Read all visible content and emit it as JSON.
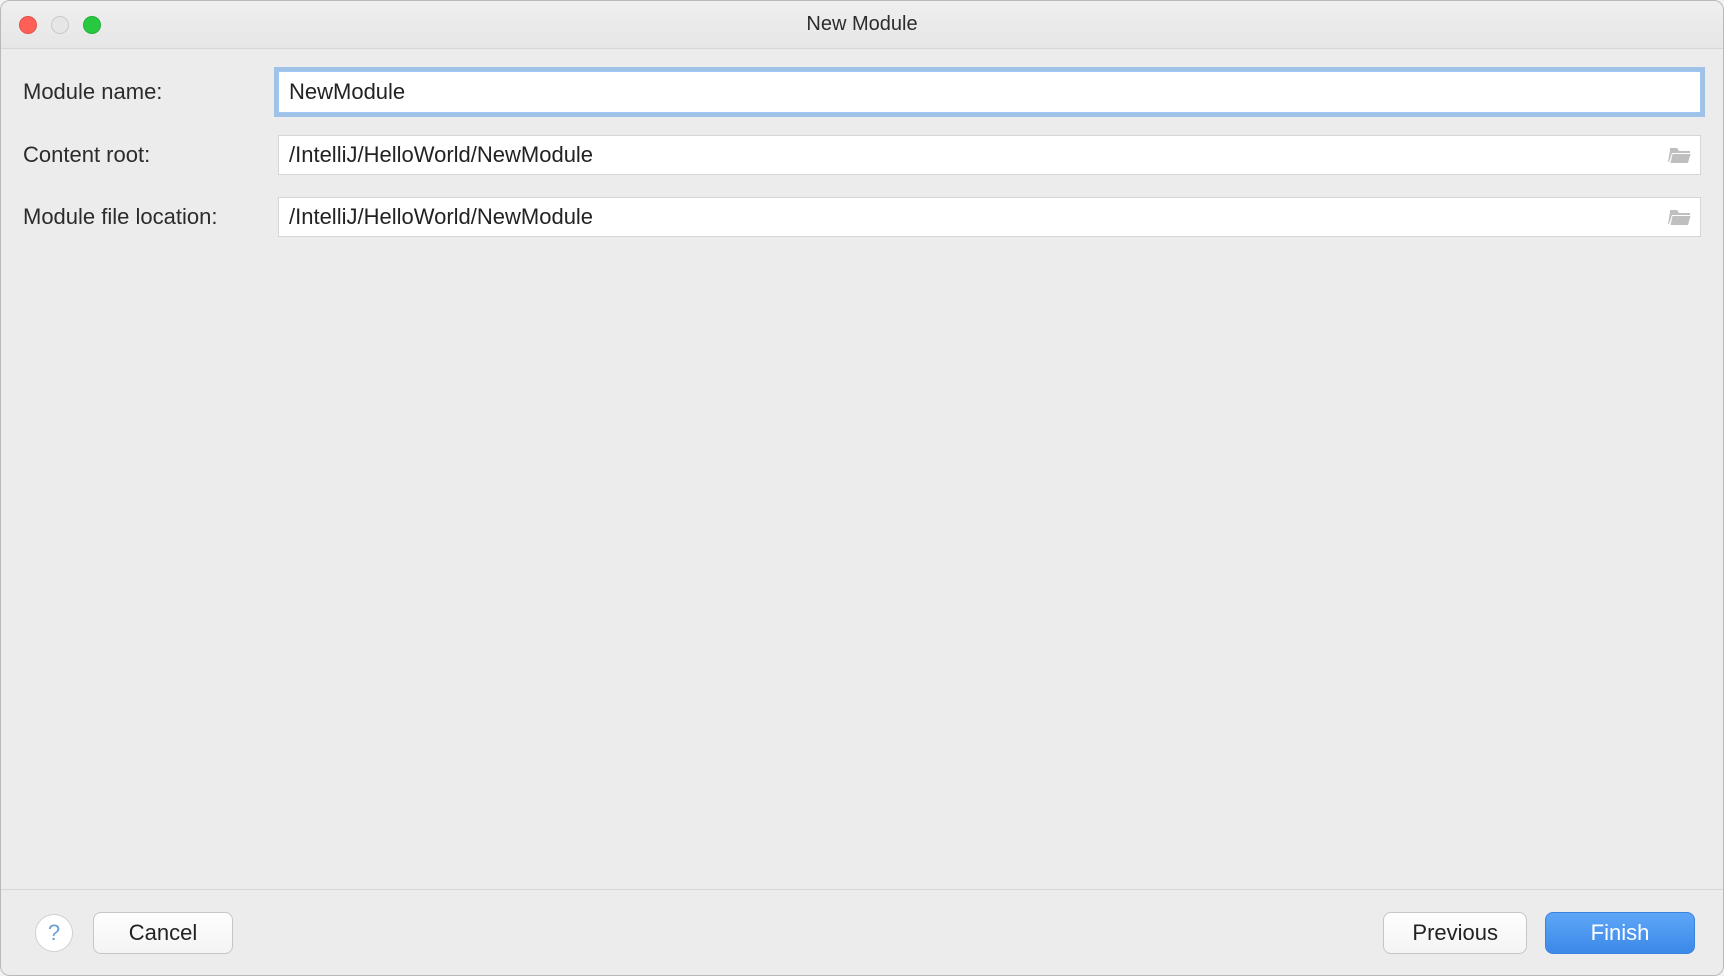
{
  "window": {
    "title": "New Module"
  },
  "form": {
    "moduleName": {
      "label": "Module name:",
      "value": "NewModule"
    },
    "contentRoot": {
      "label": "Content root:",
      "value": "/IntelliJ/HelloWorld/NewModule"
    },
    "moduleFileLocation": {
      "label": "Module file location:",
      "value": "/IntelliJ/HelloWorld/NewModule"
    }
  },
  "footer": {
    "help": "?",
    "cancel": "Cancel",
    "previous": "Previous",
    "finish": "Finish"
  }
}
